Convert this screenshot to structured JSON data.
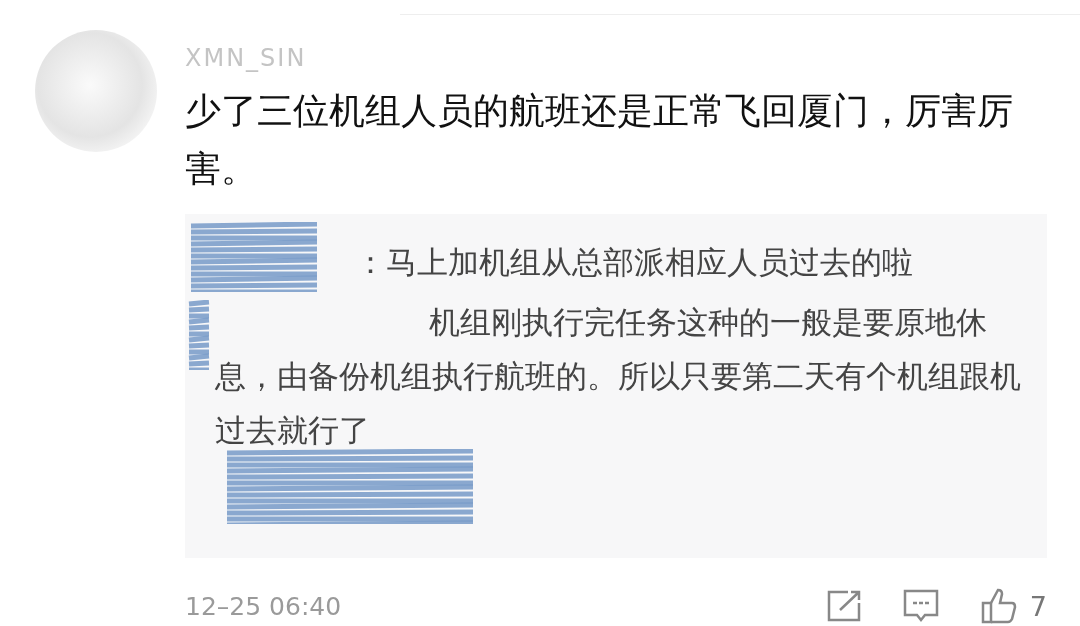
{
  "comment": {
    "author": "XMN_SIN",
    "text": "少了三位机组人员的航班还是正常飞回厦门，厉害厉害。",
    "replies": [
      {
        "text": "：马上加机组从总部派相应人员过去的啦"
      },
      {
        "text": "机组刚执行完任务这种的一般是要原地休息，由备份机组执行航班的。所以只要第二天有个机组跟机过去就行了"
      }
    ],
    "time": "12–25 06:40",
    "likes": "7"
  }
}
